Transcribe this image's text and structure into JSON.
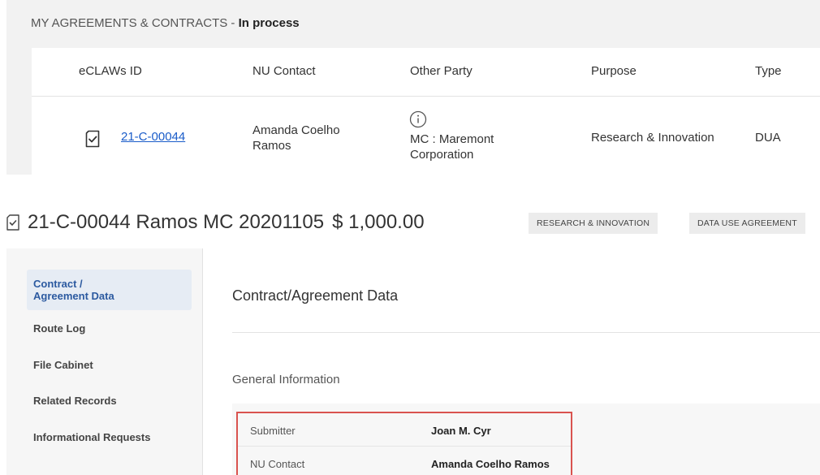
{
  "list_panel": {
    "title": "MY AGREEMENTS & CONTRACTS",
    "title_separator": " - ",
    "status": "In process",
    "columns": [
      "eCLAWs ID",
      "NU Contact",
      "Other Party",
      "Purpose",
      "Type"
    ],
    "rows": [
      {
        "id": "21-C-00044",
        "nu_contact_line1": "Amanda Coelho",
        "nu_contact_line2": "Ramos",
        "other_party_line1": "MC : Maremont",
        "other_party_line2": "Corporation",
        "purpose": "Research & Innovation",
        "type": "DUA",
        "icon": "document-check-icon",
        "info_icon": "info-icon"
      }
    ]
  },
  "record": {
    "title": "21-C-00044 Ramos MC 20201105",
    "amount": "$ 1,000.00",
    "badges": [
      "RESEARCH & INNOVATION",
      "DATA USE AGREEMENT"
    ]
  },
  "sidebar": {
    "items": [
      {
        "line1": "Contract /",
        "line2": "Agreement Data",
        "active": true
      },
      {
        "label": "Route Log"
      },
      {
        "label": "File Cabinet"
      },
      {
        "label": "Related Records"
      },
      {
        "label": "Informational Requests"
      }
    ]
  },
  "main": {
    "heading": "Contract/Agreement Data",
    "section": "General Information",
    "fields": [
      {
        "label": "Submitter",
        "value": "Joan M. Cyr"
      },
      {
        "label": "NU Contact",
        "value": "Amanda Coelho Ramos"
      }
    ]
  },
  "colors": {
    "link": "#1a5cc9",
    "highlight_border": "#d9534f",
    "active_nav_bg": "#e6ecf4",
    "active_nav_text": "#2c5aa0"
  }
}
